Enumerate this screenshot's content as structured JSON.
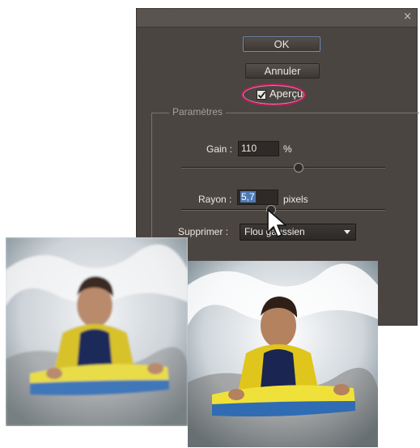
{
  "dialog": {
    "close_glyph": "×",
    "ok_label": "OK",
    "cancel_label": "Annuler",
    "preview_label": "Aperçu",
    "preview_checked": true,
    "params_legend": "Paramètres",
    "gain": {
      "label": "Gain :",
      "value": "110",
      "unit": "%"
    },
    "radius": {
      "label": "Rayon :",
      "value": "5,7",
      "unit": "pixels"
    },
    "remove": {
      "label": "Supprimer :",
      "value": "Flou gaussien"
    }
  },
  "icons": {
    "close": "close-icon",
    "checkmark": "checkmark-icon",
    "dropdown": "chevron-down-icon",
    "cursor": "mouse-pointer-icon"
  },
  "colors": {
    "dialog_bg": "#4b4541",
    "highlight_ring": "#c2185b",
    "selection": "#4d7ab5",
    "field_bg": "#2d2a28"
  },
  "images": {
    "before": "boy-bodyboarding-before",
    "after": "boy-bodyboarding-after"
  }
}
